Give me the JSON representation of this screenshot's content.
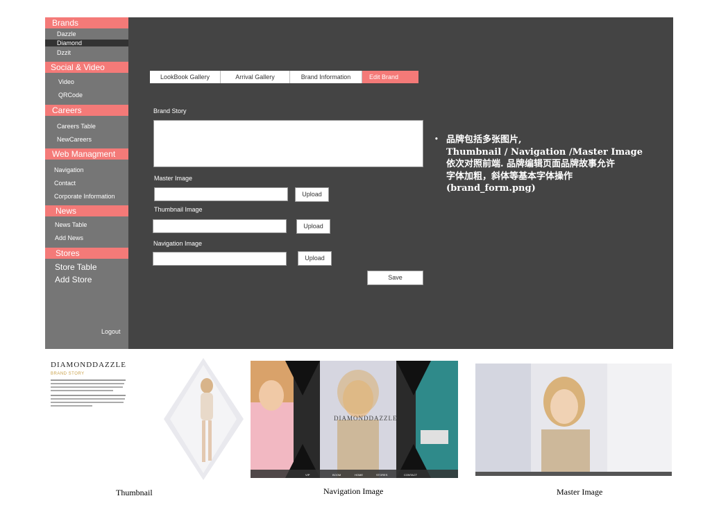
{
  "sidebar": {
    "sections": [
      {
        "label": "Brands",
        "items": [
          "Dazzle",
          "Diamond",
          "Dzzit"
        ]
      },
      {
        "label": "Social & Video",
        "items": [
          "Video",
          "QRCode"
        ]
      },
      {
        "label": "Careers",
        "items": [
          "Careers Table",
          "NewCareers"
        ]
      },
      {
        "label": "Web Managment",
        "items": [
          "Navigation",
          "Contact",
          "Corporate Information"
        ]
      },
      {
        "label": "News",
        "items": [
          "News Table",
          "Add News"
        ]
      },
      {
        "label": "Stores",
        "items": [
          "Store Table",
          "Add Store"
        ]
      }
    ],
    "logout": "Logout"
  },
  "tabs": [
    "LookBook Gallery",
    "Arrival Gallery",
    "Brand Information",
    "Edit Brand"
  ],
  "form": {
    "brand_story_label": "Brand Story",
    "master_image_label": "Master Image",
    "thumbnail_image_label": "Thumbnail Image",
    "navigation_image_label": "Navigation Image",
    "upload_label": "Upload",
    "save_label": "Save"
  },
  "note": {
    "bullet": "•",
    "lines": [
      "品牌包括多张图片,",
      "Thumbnail / Navigation /Master Image",
      "依次对照前端. 品牌编辑页面品牌故事允许",
      "字体加粗，斜体等基本字体操作",
      "(brand_form.png)"
    ]
  },
  "previews": {
    "thumbnail": {
      "logo": "DIAMONDDAZZLE",
      "subtitle": "BRAND STORY",
      "caption": "Thumbnail"
    },
    "navigation": {
      "logo": "DIAMONDDAZZLE",
      "nav_items": [
        "VIP",
        "BOOM",
        "HOME",
        "STORES",
        "CONTACT"
      ],
      "caption": "Navigation Image"
    },
    "master": {
      "caption": "Master Image"
    }
  },
  "colors": {
    "accent": "#f47a78",
    "sidebar_bg": "#767676",
    "main_bg": "#444444"
  }
}
